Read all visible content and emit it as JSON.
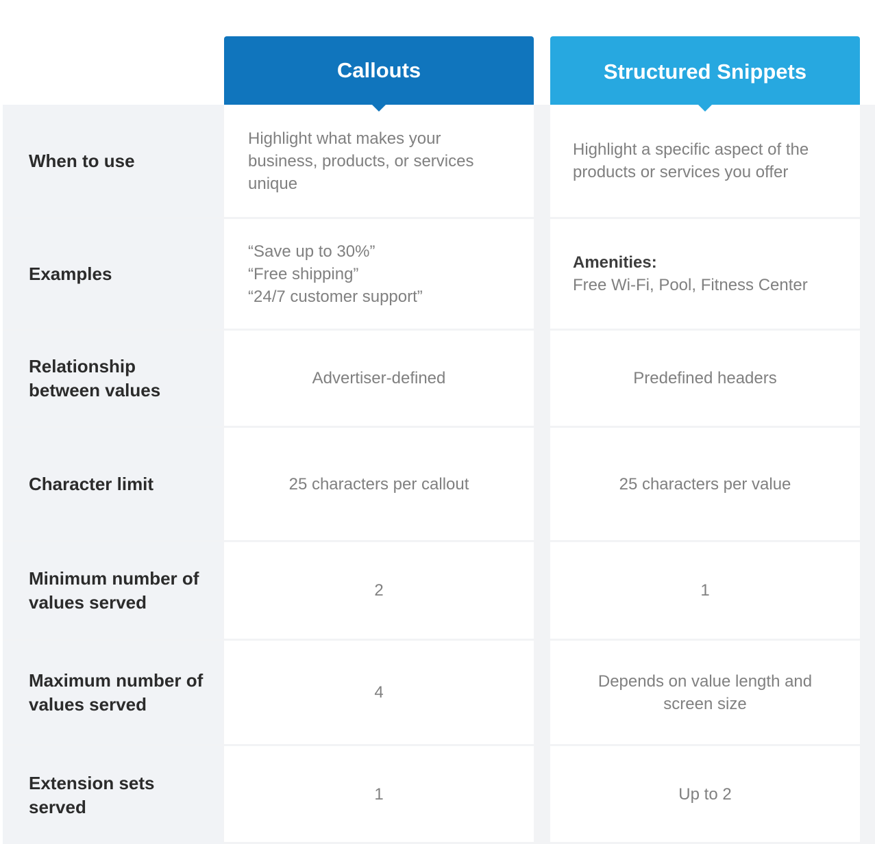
{
  "colors": {
    "callouts_header": "#1075bd",
    "snippets_header": "#27a8e0",
    "label_background": "#f1f3f6",
    "label_text": "#2b2b2b",
    "value_text": "#808080"
  },
  "columns": {
    "callouts": "Callouts",
    "snippets": "Structured Snippets"
  },
  "rows": [
    {
      "label": "When to use",
      "callouts": "Highlight what makes your business, products, or services unique",
      "snippets": "Highlight a specific aspect of the products or services you offer"
    },
    {
      "label": "Examples",
      "callouts_lines": [
        "“Save up to 30%”",
        "“Free shipping”",
        "“24/7 customer support”"
      ],
      "snippets_heading": "Amenities:",
      "snippets": "Free Wi-Fi, Pool, Fitness Center"
    },
    {
      "label": "Relationship between values",
      "callouts": "Advertiser-defined",
      "snippets": "Predefined headers"
    },
    {
      "label": "Character limit",
      "callouts": "25 characters per callout",
      "snippets": "25 characters per value"
    },
    {
      "label": "Minimum number of values served",
      "callouts": "2",
      "snippets": "1"
    },
    {
      "label": "Maximum number of values served",
      "callouts": "4",
      "snippets": "Depends on value length and screen size"
    },
    {
      "label": "Extension sets served",
      "callouts": "1",
      "snippets": "Up to 2"
    }
  ]
}
